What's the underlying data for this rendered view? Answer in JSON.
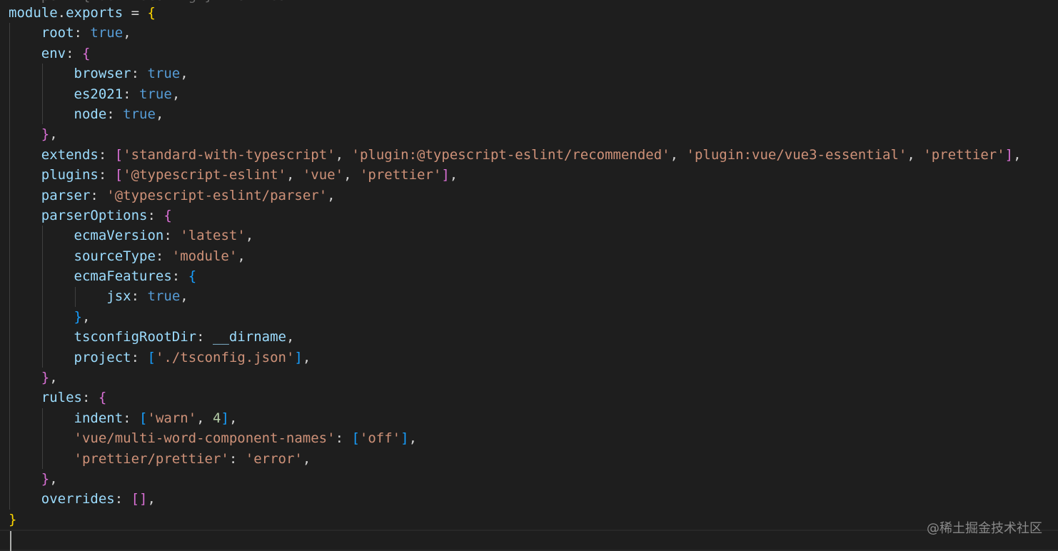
{
  "editor": {
    "theme": "Dark+",
    "colors": {
      "background": "#1e1e1e",
      "variable": "#9cdcfe",
      "property": "#9cdcfe",
      "keyword_value": "#569cd6",
      "string": "#ce9178",
      "number": "#b5cea8",
      "punctuation": "#d4d4d4",
      "brace_level1": "#ffd700",
      "brace_level2": "#da70d6",
      "brace_level3": "#179fff"
    },
    "top_partial_text": "  import { defineConfig } from 'eslint'",
    "lines": [
      [
        {
          "t": "module",
          "c": "var"
        },
        {
          "t": ".",
          "c": "p"
        },
        {
          "t": "exports",
          "c": "var"
        },
        {
          "t": " = ",
          "c": "p"
        },
        {
          "t": "{",
          "c": "b1"
        }
      ],
      [
        {
          "t": "    "
        },
        {
          "t": "root",
          "c": "var"
        },
        {
          "t": ": ",
          "c": "p"
        },
        {
          "t": "true",
          "c": "kw"
        },
        {
          "t": ",",
          "c": "p"
        }
      ],
      [
        {
          "t": "    "
        },
        {
          "t": "env",
          "c": "var"
        },
        {
          "t": ": ",
          "c": "p"
        },
        {
          "t": "{",
          "c": "b2"
        }
      ],
      [
        {
          "t": "        "
        },
        {
          "t": "browser",
          "c": "var"
        },
        {
          "t": ": ",
          "c": "p"
        },
        {
          "t": "true",
          "c": "kw"
        },
        {
          "t": ",",
          "c": "p"
        }
      ],
      [
        {
          "t": "        "
        },
        {
          "t": "es2021",
          "c": "var"
        },
        {
          "t": ": ",
          "c": "p"
        },
        {
          "t": "true",
          "c": "kw"
        },
        {
          "t": ",",
          "c": "p"
        }
      ],
      [
        {
          "t": "        "
        },
        {
          "t": "node",
          "c": "var"
        },
        {
          "t": ": ",
          "c": "p"
        },
        {
          "t": "true",
          "c": "kw"
        },
        {
          "t": ",",
          "c": "p"
        }
      ],
      [
        {
          "t": "    "
        },
        {
          "t": "}",
          "c": "b2"
        },
        {
          "t": ",",
          "c": "p"
        }
      ],
      [
        {
          "t": "    "
        },
        {
          "t": "extends",
          "c": "var"
        },
        {
          "t": ": ",
          "c": "p"
        },
        {
          "t": "[",
          "c": "b2"
        },
        {
          "t": "'standard-with-typescript'",
          "c": "str"
        },
        {
          "t": ", ",
          "c": "p"
        },
        {
          "t": "'plugin:@typescript-eslint/recommended'",
          "c": "str"
        },
        {
          "t": ", ",
          "c": "p"
        },
        {
          "t": "'plugin:vue/vue3-essential'",
          "c": "str"
        },
        {
          "t": ", ",
          "c": "p"
        },
        {
          "t": "'prettier'",
          "c": "str"
        },
        {
          "t": "]",
          "c": "b2"
        },
        {
          "t": ",",
          "c": "p"
        }
      ],
      [
        {
          "t": "    "
        },
        {
          "t": "plugins",
          "c": "var"
        },
        {
          "t": ": ",
          "c": "p"
        },
        {
          "t": "[",
          "c": "b2"
        },
        {
          "t": "'@typescript-eslint'",
          "c": "str"
        },
        {
          "t": ", ",
          "c": "p"
        },
        {
          "t": "'vue'",
          "c": "str"
        },
        {
          "t": ", ",
          "c": "p"
        },
        {
          "t": "'prettier'",
          "c": "str"
        },
        {
          "t": "]",
          "c": "b2"
        },
        {
          "t": ",",
          "c": "p"
        }
      ],
      [
        {
          "t": "    "
        },
        {
          "t": "parser",
          "c": "var"
        },
        {
          "t": ": ",
          "c": "p"
        },
        {
          "t": "'@typescript-eslint/parser'",
          "c": "str"
        },
        {
          "t": ",",
          "c": "p"
        }
      ],
      [
        {
          "t": "    "
        },
        {
          "t": "parserOptions",
          "c": "var"
        },
        {
          "t": ": ",
          "c": "p"
        },
        {
          "t": "{",
          "c": "b2"
        }
      ],
      [
        {
          "t": "        "
        },
        {
          "t": "ecmaVersion",
          "c": "var"
        },
        {
          "t": ": ",
          "c": "p"
        },
        {
          "t": "'latest'",
          "c": "str"
        },
        {
          "t": ",",
          "c": "p"
        }
      ],
      [
        {
          "t": "        "
        },
        {
          "t": "sourceType",
          "c": "var"
        },
        {
          "t": ": ",
          "c": "p"
        },
        {
          "t": "'module'",
          "c": "str"
        },
        {
          "t": ",",
          "c": "p"
        }
      ],
      [
        {
          "t": "        "
        },
        {
          "t": "ecmaFeatures",
          "c": "var"
        },
        {
          "t": ": ",
          "c": "p"
        },
        {
          "t": "{",
          "c": "b3"
        }
      ],
      [
        {
          "t": "            "
        },
        {
          "t": "jsx",
          "c": "var"
        },
        {
          "t": ": ",
          "c": "p"
        },
        {
          "t": "true",
          "c": "kw"
        },
        {
          "t": ",",
          "c": "p"
        }
      ],
      [
        {
          "t": "        "
        },
        {
          "t": "}",
          "c": "b3"
        },
        {
          "t": ",",
          "c": "p"
        }
      ],
      [
        {
          "t": "        "
        },
        {
          "t": "tsconfigRootDir",
          "c": "var"
        },
        {
          "t": ": ",
          "c": "p"
        },
        {
          "t": "__dirname",
          "c": "var"
        },
        {
          "t": ",",
          "c": "p"
        }
      ],
      [
        {
          "t": "        "
        },
        {
          "t": "project",
          "c": "var"
        },
        {
          "t": ": ",
          "c": "p"
        },
        {
          "t": "[",
          "c": "b3"
        },
        {
          "t": "'./tsconfig.json'",
          "c": "str"
        },
        {
          "t": "]",
          "c": "b3"
        },
        {
          "t": ",",
          "c": "p"
        }
      ],
      [
        {
          "t": "    "
        },
        {
          "t": "}",
          "c": "b2"
        },
        {
          "t": ",",
          "c": "p"
        }
      ],
      [
        {
          "t": "    "
        },
        {
          "t": "rules",
          "c": "var"
        },
        {
          "t": ": ",
          "c": "p"
        },
        {
          "t": "{",
          "c": "b2"
        }
      ],
      [
        {
          "t": "        "
        },
        {
          "t": "indent",
          "c": "var"
        },
        {
          "t": ": ",
          "c": "p"
        },
        {
          "t": "[",
          "c": "b3"
        },
        {
          "t": "'warn'",
          "c": "str"
        },
        {
          "t": ", ",
          "c": "p"
        },
        {
          "t": "4",
          "c": "num"
        },
        {
          "t": "]",
          "c": "b3"
        },
        {
          "t": ",",
          "c": "p"
        }
      ],
      [
        {
          "t": "        "
        },
        {
          "t": "'vue/multi-word-component-names'",
          "c": "str"
        },
        {
          "t": ": ",
          "c": "p"
        },
        {
          "t": "[",
          "c": "b3"
        },
        {
          "t": "'off'",
          "c": "str"
        },
        {
          "t": "]",
          "c": "b3"
        },
        {
          "t": ",",
          "c": "p"
        }
      ],
      [
        {
          "t": "        "
        },
        {
          "t": "'prettier/prettier'",
          "c": "str"
        },
        {
          "t": ": ",
          "c": "p"
        },
        {
          "t": "'error'",
          "c": "str"
        },
        {
          "t": ",",
          "c": "p"
        }
      ],
      [
        {
          "t": "    "
        },
        {
          "t": "}",
          "c": "b2"
        },
        {
          "t": ",",
          "c": "p"
        }
      ],
      [
        {
          "t": "    "
        },
        {
          "t": "overrides",
          "c": "var"
        },
        {
          "t": ": ",
          "c": "p"
        },
        {
          "t": "[]",
          "c": "b2"
        },
        {
          "t": ",",
          "c": "p"
        }
      ],
      [
        {
          "t": "}",
          "c": "b1"
        }
      ]
    ]
  },
  "watermark": "@稀土掘金技术社区"
}
